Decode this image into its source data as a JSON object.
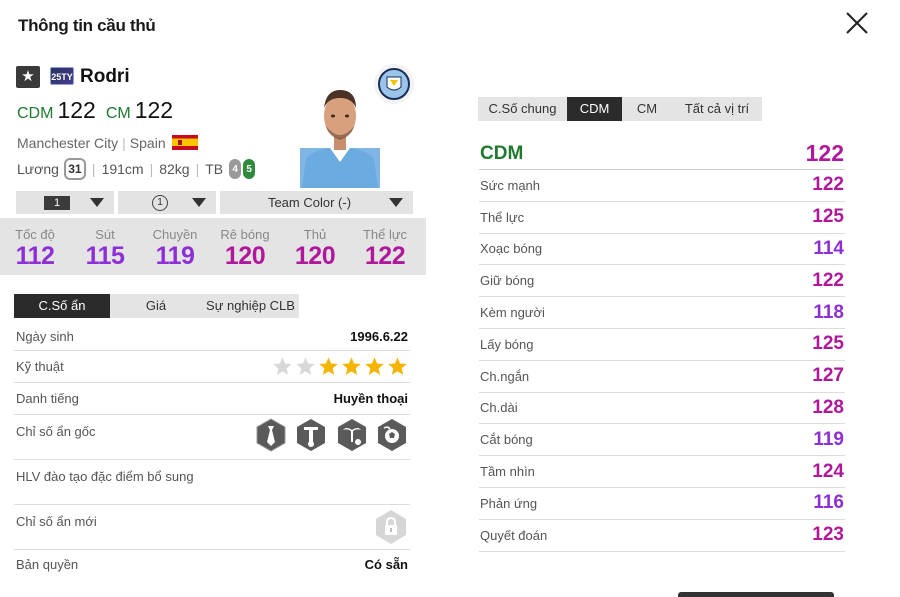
{
  "header": {
    "title": "Thông tin cầu thủ"
  },
  "player": {
    "name": "Rodri",
    "season_badge": "25TY",
    "positions": [
      {
        "pos": "CDM",
        "ovr": "122"
      },
      {
        "pos": "CM",
        "ovr": "122"
      }
    ],
    "club": "Manchester City",
    "nation": "Spain",
    "salary_label": "Lương",
    "salary": "31",
    "height": "191cm",
    "weight": "82kg",
    "body": "TB",
    "weak_foot": "4",
    "strong_foot": "5"
  },
  "selectors": {
    "upgrade": "1",
    "level": "1",
    "team_color": "Team Color (-)"
  },
  "main_stats": [
    {
      "label": "Tốc độ",
      "value": "112",
      "color": "#8e2fd6"
    },
    {
      "label": "Sút",
      "value": "115",
      "color": "#8e2fd6"
    },
    {
      "label": "Chuyền",
      "value": "119",
      "color": "#8e2fd6"
    },
    {
      "label": "Rê bóng",
      "value": "120",
      "color": "#b0189b"
    },
    {
      "label": "Thủ",
      "value": "120",
      "color": "#b0189b"
    },
    {
      "label": "Thể lực",
      "value": "122",
      "color": "#b0189b"
    }
  ],
  "left_tabs": [
    "C.Số ẩn",
    "Giá",
    "Sự nghiệp CLB"
  ],
  "info": {
    "dob_label": "Ngày sinh",
    "dob": "1996.6.22",
    "skill_label": "Kỹ thuật",
    "skill_stars": 4,
    "skill_max": 6,
    "reputation_label": "Danh tiếng",
    "reputation": "Huyền thoại",
    "traits_label": "Chỉ số ẩn gốc",
    "coach_label": "HLV đào tạo đặc điểm bổ sung",
    "new_traits_label": "Chỉ số ẩn mới",
    "license_label": "Bản quyền",
    "license": "Có sẵn"
  },
  "trait_icons": [
    "tie-trait-icon",
    "bench-trait-icon",
    "palm-trait-icon",
    "ball-trait-icon"
  ],
  "right_tabs": [
    "C.Số chung",
    "CDM",
    "CM",
    "Tất cả vị trí"
  ],
  "detail": {
    "position": "CDM",
    "overall": "122",
    "rows": [
      {
        "label": "Sức mạnh",
        "value": "122",
        "color": "#b0189b"
      },
      {
        "label": "Thể lực",
        "value": "125",
        "color": "#b0189b"
      },
      {
        "label": "Xoạc bóng",
        "value": "114",
        "color": "#8e2fd6"
      },
      {
        "label": "Giữ bóng",
        "value": "122",
        "color": "#b0189b"
      },
      {
        "label": "Kèm người",
        "value": "118",
        "color": "#8e2fd6"
      },
      {
        "label": "Lấy bóng",
        "value": "125",
        "color": "#b0189b"
      },
      {
        "label": "Ch.ngắn",
        "value": "127",
        "color": "#b0189b"
      },
      {
        "label": "Ch.dài",
        "value": "128",
        "color": "#b0189b"
      },
      {
        "label": "Cắt bóng",
        "value": "119",
        "color": "#8e2fd6"
      },
      {
        "label": "Tầm nhìn",
        "value": "124",
        "color": "#b0189b"
      },
      {
        "label": "Phản ứng",
        "value": "116",
        "color": "#8e2fd6"
      },
      {
        "label": "Quyết đoán",
        "value": "123",
        "color": "#b0189b"
      }
    ]
  }
}
